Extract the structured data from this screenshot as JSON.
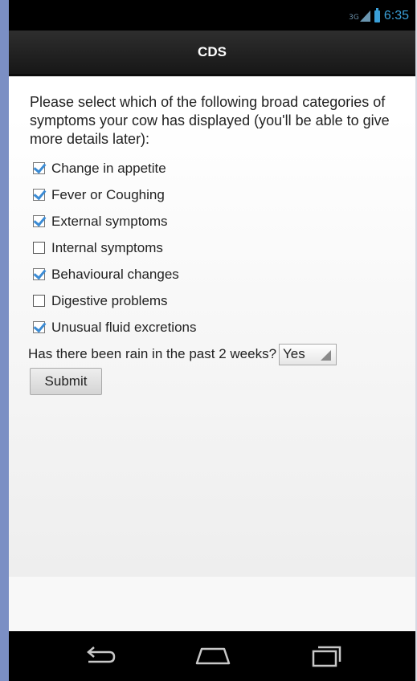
{
  "status_bar": {
    "network": "3G",
    "time": "6:35",
    "signal_icon": "signal-icon",
    "battery_icon": "battery-icon"
  },
  "action_bar": {
    "title": "CDS"
  },
  "form": {
    "prompt": "Please select which of the following broad categories of symptoms your cow has displayed (you'll be able to give more details later):",
    "options": [
      {
        "label": "Change in appetite",
        "checked": true
      },
      {
        "label": "Fever or Coughing",
        "checked": true
      },
      {
        "label": "External symptoms",
        "checked": true
      },
      {
        "label": "Internal symptoms",
        "checked": false
      },
      {
        "label": "Behavioural changes",
        "checked": true
      },
      {
        "label": "Digestive problems",
        "checked": false
      },
      {
        "label": "Unusual fluid excretions",
        "checked": true
      }
    ],
    "rain_question": "Has there been rain in the past 2 weeks?",
    "rain_value": "Yes",
    "submit_label": "Submit"
  },
  "nav_bar": {
    "back_icon": "back-icon",
    "home_icon": "home-icon",
    "recents_icon": "recents-icon"
  },
  "colors": {
    "accent": "#3aa0d9",
    "checkmark": "#3b8bd4",
    "action_bar": "#1f1f1f"
  }
}
